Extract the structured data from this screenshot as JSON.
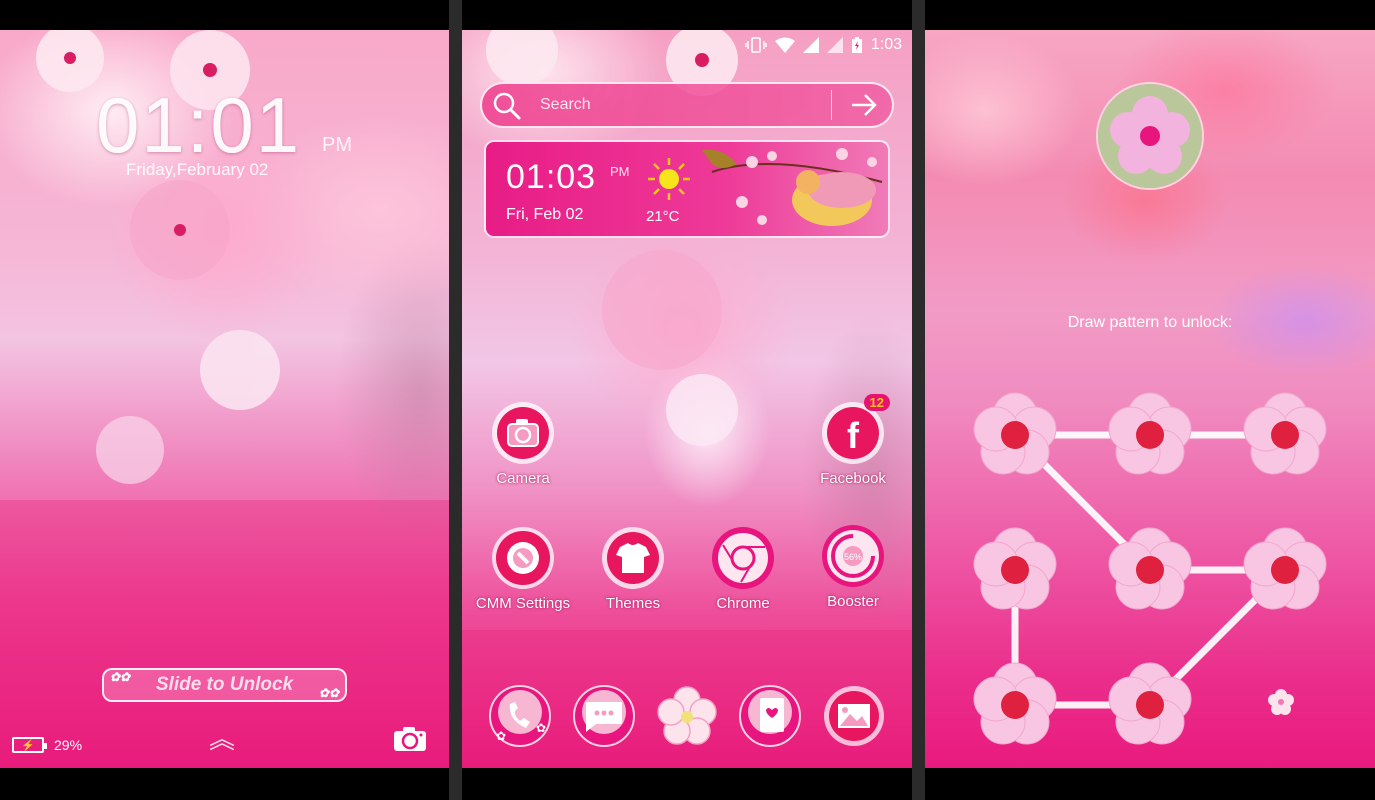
{
  "lock_screen": {
    "time": "01:01",
    "ampm": "PM",
    "date": "Friday,February 02",
    "slide_label": "Slide to Unlock",
    "battery_percent": "29%",
    "battery_icon": "battery-charging-icon",
    "unlock_icon": "chevron-up-icon",
    "camera_icon": "camera-icon"
  },
  "home_screen": {
    "status_bar": {
      "time": "1:03",
      "icons": [
        "vibrate-icon",
        "wifi-icon",
        "signal-icon",
        "signal-icon",
        "battery-charging-icon"
      ]
    },
    "search": {
      "placeholder": "Search",
      "search_icon": "search-icon",
      "go_icon": "arrow-right-icon"
    },
    "widget": {
      "time": "01:03",
      "ampm": "PM",
      "date": "Fri, Feb 02",
      "temperature": "21°C",
      "weather_icon": "sun-icon"
    },
    "apps": [
      {
        "label": "Camera",
        "icon": "camera-icon"
      },
      {
        "label": "Facebook",
        "icon": "facebook-icon",
        "badge": "12"
      },
      {
        "label": "CMM Settings",
        "icon": "settings-gear-icon"
      },
      {
        "label": "Themes",
        "icon": "tshirt-icon"
      },
      {
        "label": "Chrome",
        "icon": "chrome-icon"
      },
      {
        "label": "Booster",
        "icon": "booster-gauge-icon",
        "value": "56%"
      }
    ],
    "dock": [
      {
        "name": "phone",
        "icon": "phone-icon"
      },
      {
        "name": "messages",
        "icon": "chat-icon"
      },
      {
        "name": "app-drawer",
        "icon": "blossom-icon"
      },
      {
        "name": "contacts",
        "icon": "contacts-book-icon"
      },
      {
        "name": "gallery",
        "icon": "gallery-icon"
      }
    ],
    "colors": {
      "accent": "#e8157e",
      "badge_text": "#f9c21f"
    }
  },
  "pattern_screen": {
    "hint": "Draw pattern to unlock:",
    "pattern_sequence": [
      3,
      1,
      5,
      6,
      8,
      7,
      4
    ],
    "grid": "3x3",
    "avatar_icon": "blossom-avatar"
  }
}
